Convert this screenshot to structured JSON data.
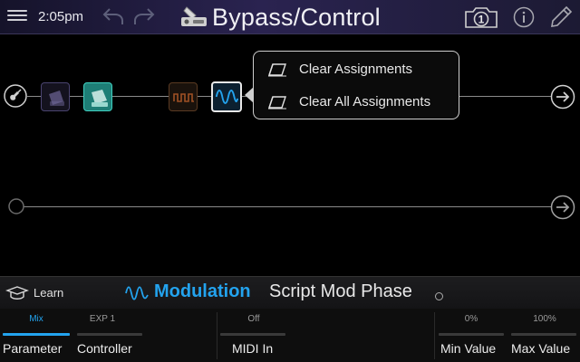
{
  "header": {
    "time": "2:05pm",
    "title": "Bypass/Control",
    "snapshot_number": "1"
  },
  "popup": {
    "items": [
      "Clear Assignments",
      "Clear All Assignments"
    ]
  },
  "model": {
    "learn_label": "Learn",
    "category": "Modulation",
    "name": "Script Mod Phase"
  },
  "params": [
    {
      "label": "Parameter",
      "value": "Mix",
      "fill": 1.0,
      "selected": true
    },
    {
      "label": "Controller",
      "value": "EXP 1",
      "fill": 0
    },
    {
      "label": "MIDI In",
      "value": "Off",
      "fill": 0
    },
    {
      "label": "Min Value",
      "value": "0%",
      "fill": 0
    },
    {
      "label": "Max Value",
      "value": "100%",
      "fill": 0
    }
  ],
  "colors": {
    "accent": "#23a3ee",
    "modulation": "#23a3ee",
    "wah_block": "#2ab8a8",
    "volume_block": "#7a6fb0",
    "tremolo_block": "#c0602a"
  },
  "icons": {
    "menu": "menu-icon",
    "undo": "undo-icon",
    "redo": "redo-icon",
    "footswitch": "footswitch-icon",
    "snapshot": "camera-icon",
    "info": "info-icon",
    "edit": "pencil-icon",
    "input": "guitar-input-icon",
    "output": "output-arrow-icon",
    "learn": "learn-icon",
    "eraser": "eraser-icon"
  }
}
